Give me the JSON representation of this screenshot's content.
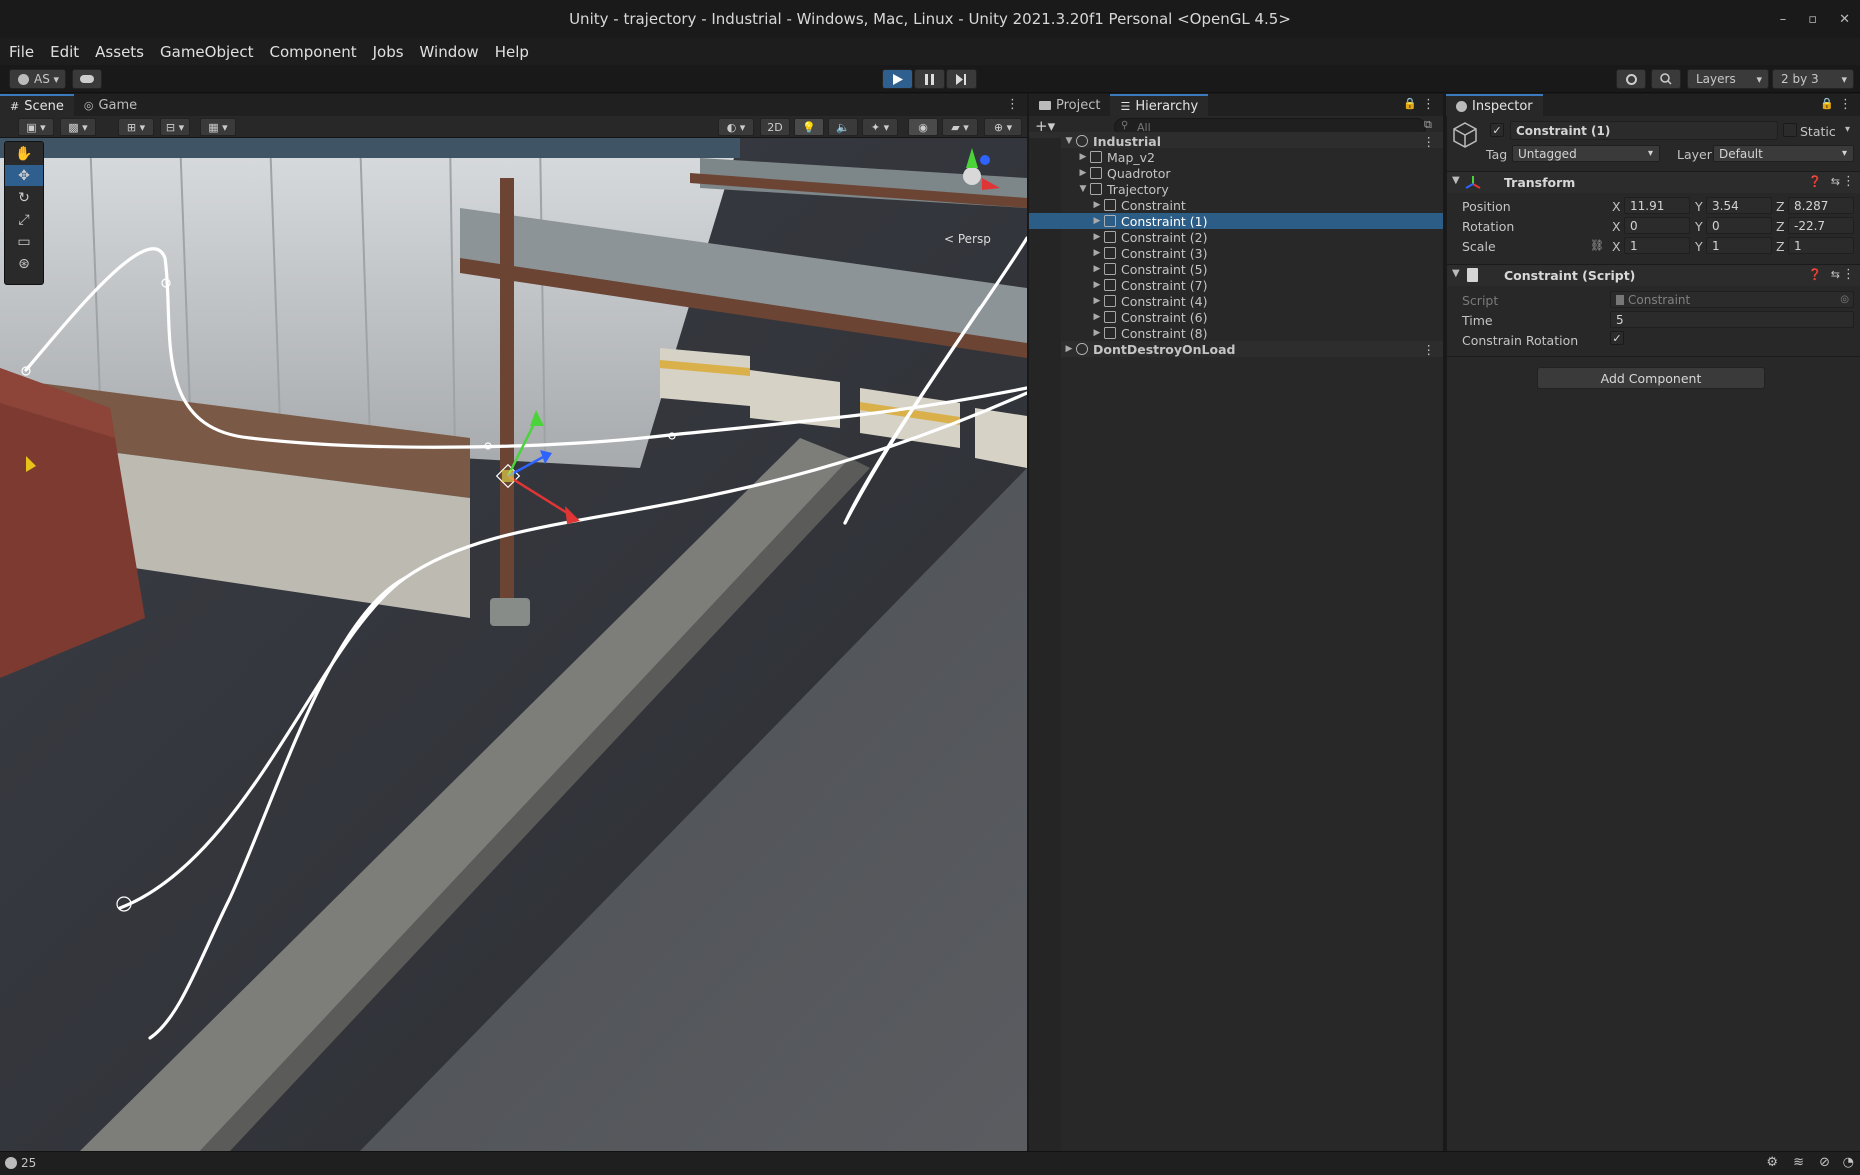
{
  "window": {
    "title": "Unity - trajectory - Industrial - Windows, Mac, Linux - Unity 2021.3.20f1 Personal <OpenGL 4.5>",
    "controls": [
      "–",
      "▫",
      "✕"
    ]
  },
  "menu": [
    "File",
    "Edit",
    "Assets",
    "GameObject",
    "Component",
    "Jobs",
    "Window",
    "Help"
  ],
  "toolbar": {
    "account": "AS",
    "layers": "Layers",
    "layout": "2 by 3"
  },
  "scene_tabs": [
    "Scene",
    "Game"
  ],
  "scene_toolbar": {
    "mode_2d": "2D",
    "persp_label": "< Persp"
  },
  "hierarchy_tabs": [
    "Project",
    "Hierarchy"
  ],
  "hierarchy": {
    "search_placeholder": "All",
    "items": [
      {
        "label": "Industrial",
        "depth": 0,
        "kind": "scene",
        "expanded": true
      },
      {
        "label": "Map_v2",
        "depth": 1,
        "kind": "object",
        "expanded": false
      },
      {
        "label": "Quadrotor",
        "depth": 1,
        "kind": "object",
        "expanded": false
      },
      {
        "label": "Trajectory",
        "depth": 1,
        "kind": "object",
        "expanded": true
      },
      {
        "label": "Constraint",
        "depth": 2,
        "kind": "object",
        "expanded": false
      },
      {
        "label": "Constraint (1)",
        "depth": 2,
        "kind": "object",
        "expanded": false,
        "selected": true
      },
      {
        "label": "Constraint (2)",
        "depth": 2,
        "kind": "object",
        "expanded": false
      },
      {
        "label": "Constraint (3)",
        "depth": 2,
        "kind": "object",
        "expanded": false
      },
      {
        "label": "Constraint (5)",
        "depth": 2,
        "kind": "object",
        "expanded": false
      },
      {
        "label": "Constraint (7)",
        "depth": 2,
        "kind": "object",
        "expanded": false
      },
      {
        "label": "Constraint (4)",
        "depth": 2,
        "kind": "object",
        "expanded": false
      },
      {
        "label": "Constraint (6)",
        "depth": 2,
        "kind": "object",
        "expanded": false
      },
      {
        "label": "Constraint (8)",
        "depth": 2,
        "kind": "object",
        "expanded": false
      },
      {
        "label": "DontDestroyOnLoad",
        "depth": 0,
        "kind": "scene",
        "expanded": false
      }
    ]
  },
  "inspector": {
    "tab": "Inspector",
    "object_name": "Constraint (1)",
    "static_label": "Static",
    "tag_label": "Tag",
    "tag_value": "Untagged",
    "layer_label": "Layer",
    "layer_value": "Default",
    "transform": {
      "title": "Transform",
      "position_label": "Position",
      "rotation_label": "Rotation",
      "scale_label": "Scale",
      "position": {
        "x": "11.91",
        "y": "3.54",
        "z": "8.287"
      },
      "rotation": {
        "x": "0",
        "y": "0",
        "z": "-22.7"
      },
      "scale": {
        "x": "1",
        "y": "1",
        "z": "1"
      }
    },
    "script_component": {
      "title": "Constraint (Script)",
      "script_label": "Script",
      "script_value": "Constraint",
      "time_label": "Time",
      "time_value": "5",
      "constrain_rotation_label": "Constrain Rotation",
      "constrain_rotation_checked": true
    },
    "add_component": "Add Component"
  },
  "axis_letters": {
    "x": "X",
    "y": "Y",
    "z": "Z"
  },
  "status": {
    "count": "25"
  },
  "colors": {
    "selection": "#2c5d87",
    "accent": "#3a79bb",
    "play_active": "#2f5f8f"
  }
}
